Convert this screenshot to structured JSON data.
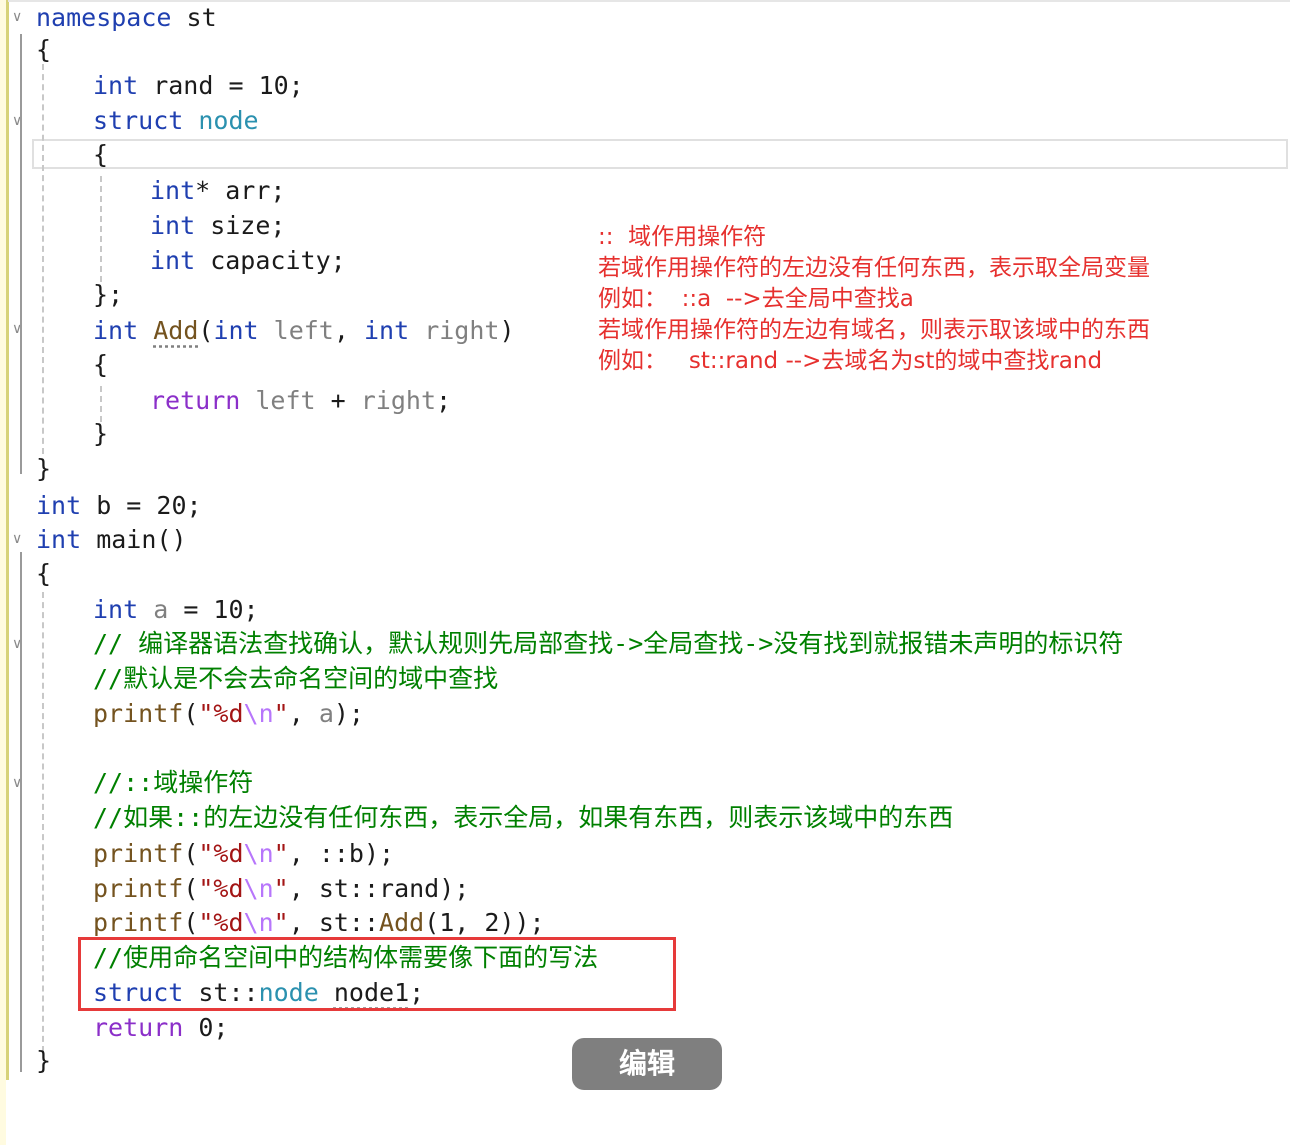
{
  "code": {
    "l1_kw": "namespace",
    "l1_name": " st",
    "brace_open": "{",
    "brace_close": "}",
    "semi_close": "};",
    "int": "int",
    "struct": "struct",
    "return": "return",
    "rand_decl": " rand = 10;",
    "node": "node",
    "arr_decl": "* arr;",
    "size_decl": " size;",
    "cap_decl": " capacity;",
    "add_name": "Add",
    "left": "left",
    "right": "right",
    "add_open": "(",
    "comma": ", ",
    "add_close": ")",
    "ret_expr_plus": " + ",
    "semi": ";",
    "b_decl": " b = 20;",
    "main_decl": " main()",
    "a_var": "a",
    "a_rest": " = 10;",
    "comment1": "// 编译器语法查找确认，默认规则先局部查找->全局查找->没有找到就报错未声明的标识符",
    "comment2": "//默认是不会去命名空间的域中查找",
    "printf": "printf",
    "fmt_q1": "\"%d",
    "fmt_esc": "\\n",
    "fmt_q2": "\"",
    "arg_a": "a",
    "comment3": "//::域操作符",
    "comment4": "//如果::的左边没有任何东西，表示全局，如果有东西，则表示该域中的东西",
    "arg_b": "::b",
    "arg_rand": "st::rand",
    "arg_add_prefix": "st::",
    "arg_add_args": "(1, 2)",
    "comment5": "//使用命名空间中的结构体需要像下面的写法",
    "st_scope": " st::",
    "node1": "node1",
    "ret0": " 0;"
  },
  "annotation": {
    "line1": "::  域作用操作符",
    "line2": "若域作用操作符的左边没有任何东西，表示取全局变量",
    "line3": "例如：  ::a  -->去全局中查找a",
    "line4": "若域作用操作符的左边有域名，则表示取该域中的东西",
    "line5": "例如：   st::rand -->去域名为st的域中查找rand"
  },
  "overlay": {
    "edit_button": "编辑"
  },
  "colors": {
    "keyword": "#1f3fb0",
    "control_keyword": "#8b2fc9",
    "type": "#2b91af",
    "function": "#74531f",
    "comment": "#008000",
    "string": "#a31515",
    "annotation": "#e6302e",
    "highlight_box": "#e63a3a"
  }
}
